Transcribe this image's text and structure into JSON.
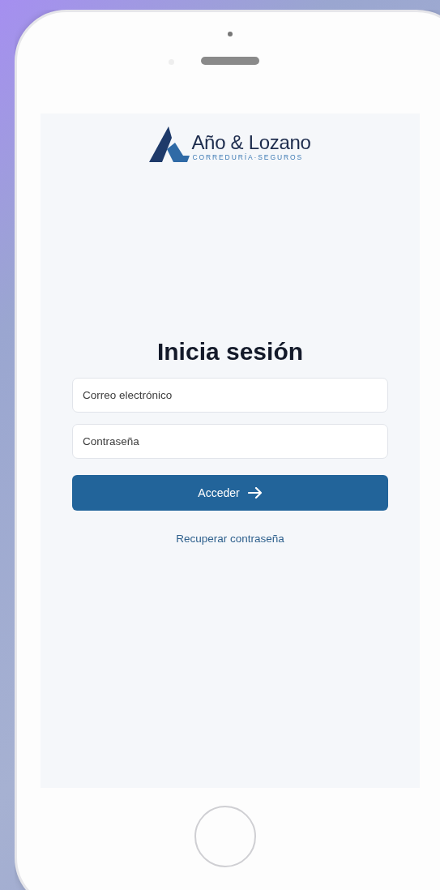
{
  "logo": {
    "name": "Año & Lozano",
    "tagline": "CORREDURÍA·SEGUROS"
  },
  "title": "Inicia sesión",
  "fields": [
    {
      "placeholder": "Correo electrónico"
    },
    {
      "placeholder": "Contraseña"
    }
  ],
  "button": {
    "label": "Acceder"
  },
  "link": "Recuperar contraseña"
}
